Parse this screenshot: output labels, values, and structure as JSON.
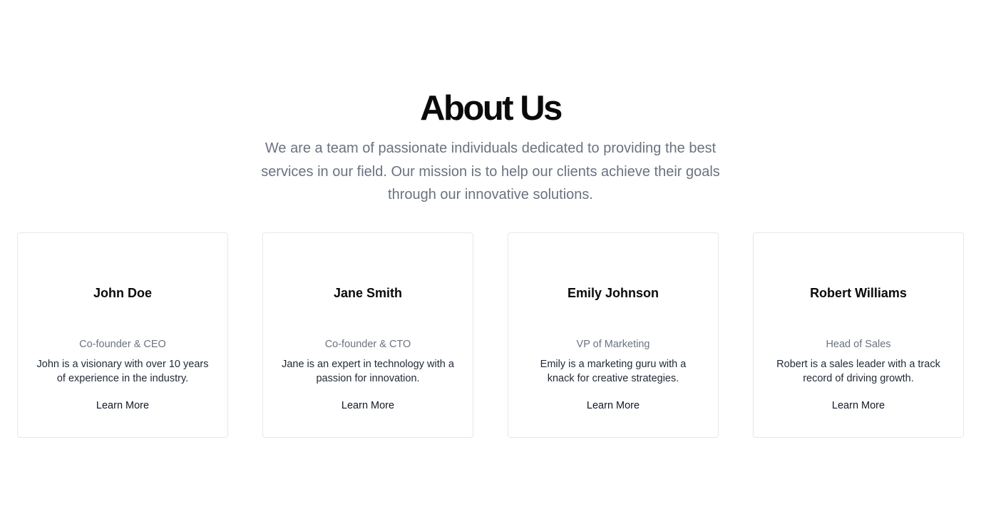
{
  "header": {
    "title": "About Us",
    "description": "We are a team of passionate individuals dedicated to providing the best services in our field. Our mission is to help our clients achieve their goals through our innovative solutions."
  },
  "team": [
    {
      "name": "John Doe",
      "role": "Co-founder & CEO",
      "bio": "John is a visionary with over 10 years of experience in the industry.",
      "link_label": "Learn More"
    },
    {
      "name": "Jane Smith",
      "role": "Co-founder & CTO",
      "bio": "Jane is an expert in technology with a passion for innovation.",
      "link_label": "Learn More"
    },
    {
      "name": "Emily Johnson",
      "role": "VP of Marketing",
      "bio": "Emily is a marketing guru with a knack for creative strategies.",
      "link_label": "Learn More"
    },
    {
      "name": "Robert Williams",
      "role": "Head of Sales",
      "bio": "Robert is a sales leader with a track record of driving growth.",
      "link_label": "Learn More"
    }
  ],
  "colors": {
    "background": "#ffffff",
    "heading": "#0a0a0a",
    "muted_text": "#6b7280",
    "card_border": "#e5e7eb"
  }
}
